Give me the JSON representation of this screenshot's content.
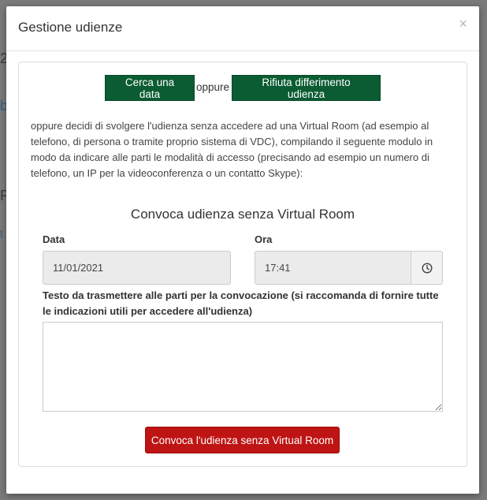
{
  "background": {
    "fragments": [
      "2",
      "b",
      "R",
      "t"
    ]
  },
  "modal": {
    "title": "Gestione udienze",
    "close_symbol": "×"
  },
  "actions": {
    "search_date_label": "Cerca una data",
    "or_text": "oppure",
    "refuse_label": "Rifiuta differimento udienza"
  },
  "description": "oppure decidi di svolgere l'udienza senza accedere ad una Virtual Room (ad esempio al telefono, di persona o tramite proprio sistema di VDC), compilando il seguente modulo in modo da indicare alle parti le modalità di accesso (precisando ad esempio un numero di telefono, un IP per la videoconferenza o un contatto Skype):",
  "form": {
    "section_title": "Convoca udienza senza Virtual Room",
    "date_label": "Data",
    "date_value": "11/01/2021",
    "time_label": "Ora",
    "time_value": "17:41",
    "time_icon": "clock-icon",
    "message_label": "Testo da trasmettere alle parti per la convocazione (si raccomanda di fornire tutte le indicazioni utili per accedere all'udienza)",
    "message_value": "",
    "submit_label": "Convoca l'udienza senza Virtual Room"
  },
  "colors": {
    "green_button": "#0b5c33",
    "red_button": "#bf1414",
    "overlay": "#7a7a7a"
  }
}
